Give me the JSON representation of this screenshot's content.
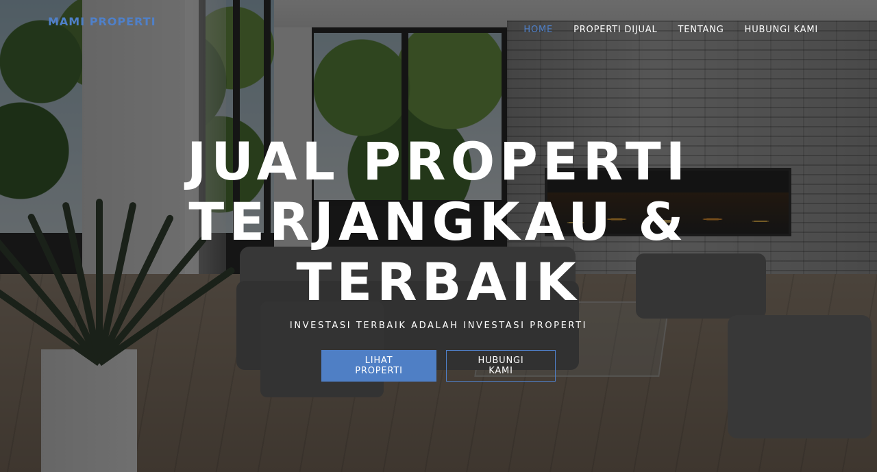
{
  "brand": {
    "name": "MAMI PROPERTI"
  },
  "nav": {
    "items": [
      {
        "label": "HOME",
        "active": true
      },
      {
        "label": "PROPERTI DIJUAL",
        "active": false
      },
      {
        "label": "TENTANG",
        "active": false
      },
      {
        "label": "HUBUNGI KAMI",
        "active": false
      }
    ]
  },
  "hero": {
    "title_lines": [
      "JUAL PROPERTI",
      "TERJANGKAU &",
      "TERBAIK"
    ],
    "subtitle": "INVESTASI TERBAIK ADALAH INVESTASI PROPERTI",
    "primary_button": "LIHAT PROPERTI",
    "secondary_button": "HUBUNGI KAMI"
  },
  "colors": {
    "accent": "#4f80c9",
    "text": "#ffffff",
    "overlay": "rgba(15,15,15,0.58)"
  }
}
